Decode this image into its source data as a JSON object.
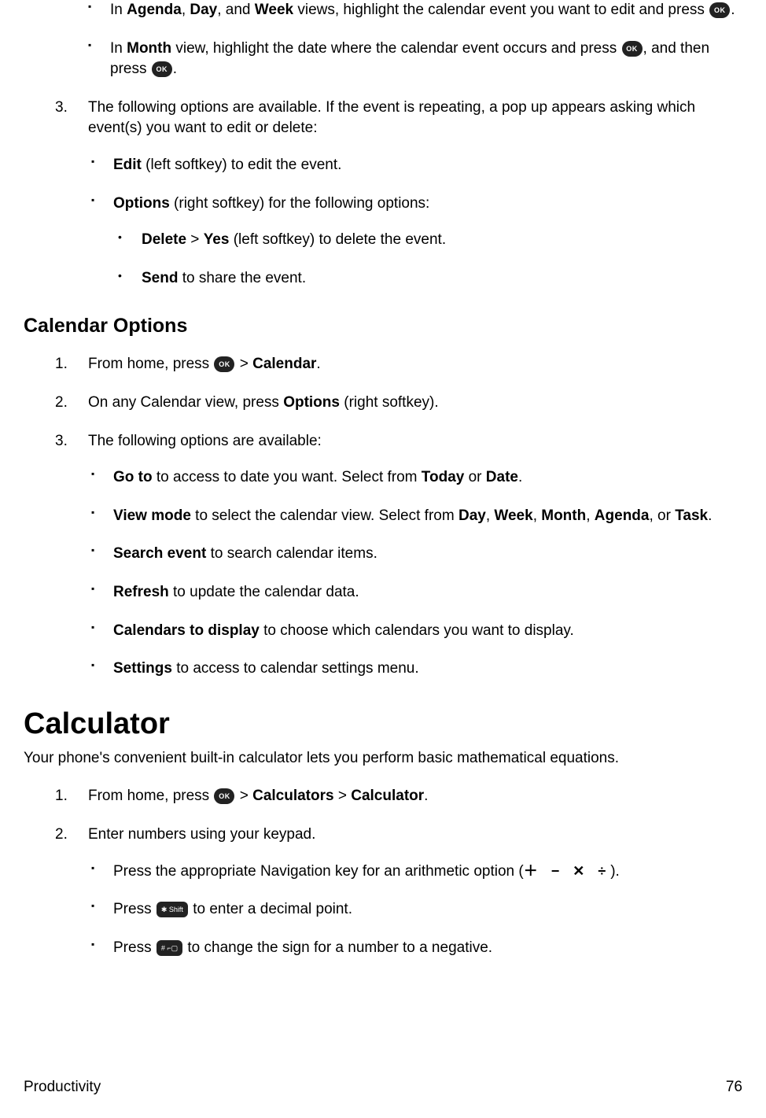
{
  "top": {
    "b1_pre": "In ",
    "b1_agenda": "Agenda",
    "b1_sep1": ", ",
    "b1_day": "Day",
    "b1_sep2": ", and ",
    "b1_week": "Week",
    "b1_post": " views, highlight the calendar event you want to edit and press ",
    "b1_period": ".",
    "b2_pre": "In ",
    "b2_month": "Month",
    "b2_mid1": " view, highlight the date where the calendar event occurs and press ",
    "b2_mid2": ", and then press ",
    "b2_period": "."
  },
  "step3": {
    "intro": "The following options are available. If the event is repeating, a pop up appears asking which event(s) you want to edit or delete:",
    "edit_b": "Edit",
    "edit_t": " (left softkey) to edit the event.",
    "opt_b": "Options",
    "opt_t": " (right softkey) for the following options:",
    "del_b1": "Delete",
    "del_gt": " > ",
    "del_b2": "Yes",
    "del_t": " (left softkey) to delete the event.",
    "send_b": "Send",
    "send_t": " to share the event."
  },
  "calopt": {
    "heading": "Calendar Options",
    "s1_pre": "From home, press ",
    "s1_gt": " > ",
    "s1_cal": "Calendar",
    "s1_period": ".",
    "s2_pre": "On any Calendar view, press ",
    "s2_opt": "Options",
    "s2_post": " (right softkey).",
    "s3": "The following options are available:",
    "goto_b": "Go to",
    "goto_t1": " to access to date you want. Select from ",
    "goto_today": "Today",
    "goto_or": " or ",
    "goto_date": "Date",
    "goto_p": ".",
    "view_b": "View mode",
    "view_t1": " to select the calendar view. Select from ",
    "view_day": "Day",
    "view_c1": ", ",
    "view_week": "Week",
    "view_c2": ", ",
    "view_month": "Month",
    "view_c3": ", ",
    "view_agenda": "Agenda",
    "view_or": ", or ",
    "view_task": "Task",
    "view_p": ".",
    "search_b": "Search event",
    "search_t": " to search calendar items.",
    "refresh_b": "Refresh",
    "refresh_t": " to update the calendar data.",
    "caldisp_b": "Calendars to display",
    "caldisp_t": " to choose which calendars you want to display.",
    "settings_b": "Settings",
    "settings_t": " to access to calendar settings menu."
  },
  "calc": {
    "heading": "Calculator",
    "sub": "Your phone's convenient built-in calculator lets you perform basic mathematical equations.",
    "s1_pre": "From home, press ",
    "s1_gt": " > ",
    "s1_calcs": "Calculators",
    "s1_gt2": " > ",
    "s1_calc": "Calculator",
    "s1_p": ".",
    "s2": "Enter numbers using your keypad.",
    "nav_pre": "Press the appropriate Navigation key for an arithmetic option (",
    "nav_post": ").",
    "dec_pre": "Press ",
    "dec_post": " to enter a decimal point.",
    "neg_pre": "Press ",
    "neg_post": " to change the sign for a number to a negative."
  },
  "icons": {
    "ok": "OK",
    "shift": "✱ Shift",
    "pound": "# ⌐▢",
    "arith": "＋ − ✕ ÷"
  },
  "footer": {
    "left": "Productivity",
    "right": "76"
  }
}
